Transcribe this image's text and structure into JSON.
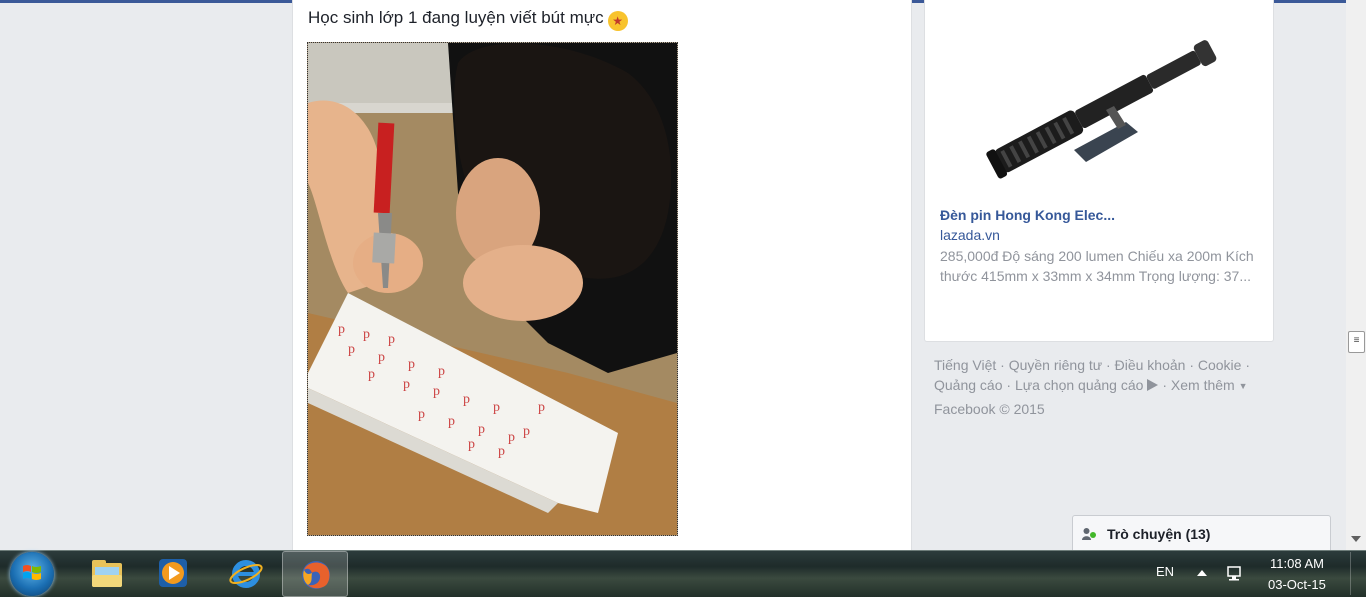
{
  "post": {
    "caption": "Học sinh lớp 1 đang luyện viết bút mực",
    "emoji": "star-struck-emoji"
  },
  "sponsored_ad": {
    "title": "Đèn pin Hong Kong Elec...",
    "domain": "lazada.vn",
    "description": "285,000đ Độ sáng 200 lumen Chiếu xa 200m Kích thước 415mm x 33mm x 34mm Trọng lượng: 37..."
  },
  "footer": {
    "links": [
      "Tiếng Việt",
      "Quyền riêng tư",
      "Điều khoản",
      "Cookie",
      "Quảng cáo",
      "Lựa chọn quảng cáo",
      "Xem thêm"
    ],
    "separator": "·",
    "copyright": "Facebook © 2015"
  },
  "chat": {
    "label": "Trò chuyện (13)"
  },
  "taskbar": {
    "apps": [
      "windows-explorer-icon",
      "media-player-icon",
      "internet-explorer-icon",
      "firefox-icon"
    ],
    "active_app": "firefox-icon",
    "language": "EN",
    "time": "11:08 AM",
    "date": "03-Oct-15"
  },
  "colors": {
    "page_bg": "#e9ebee",
    "link_blue": "#365899",
    "muted_text": "#90949c",
    "brand_blue": "#3b5998"
  }
}
